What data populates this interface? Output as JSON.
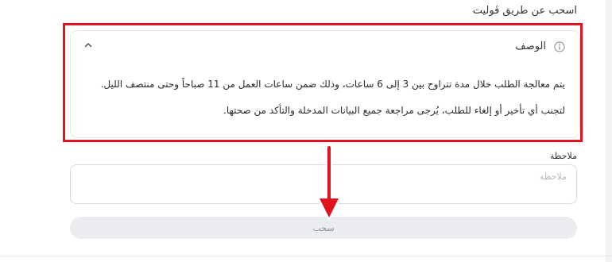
{
  "section": {
    "title": "اسحب عن طريق ڤوليت"
  },
  "description": {
    "title": "الوصف",
    "line1": "يتم معالجة الطلب خلال مدة تتراوح بين 3 إلى 6 ساعات، وذلك ضمن ساعات العمل من 11 صباحاً وحتى منتصف الليل.",
    "line2": "لتجنب أي تأخير أو إلغاء للطلب، يُرجى مراجعة جميع البيانات المدخلة والتأكد من صحتها.",
    "icons": {
      "info": "info-icon",
      "collapse": "chevron-up-icon"
    }
  },
  "note": {
    "label": "ملاحظة",
    "value": "",
    "placeholder": "ملاحظة"
  },
  "withdraw": {
    "label": "سحب"
  },
  "annotation": {
    "highlight_color": "#e0141e",
    "arrow_color": "#e0141e"
  },
  "colors": {
    "button_bg": "#eaecef",
    "button_text": "#8a8f96",
    "border": "#e2e6ea"
  }
}
